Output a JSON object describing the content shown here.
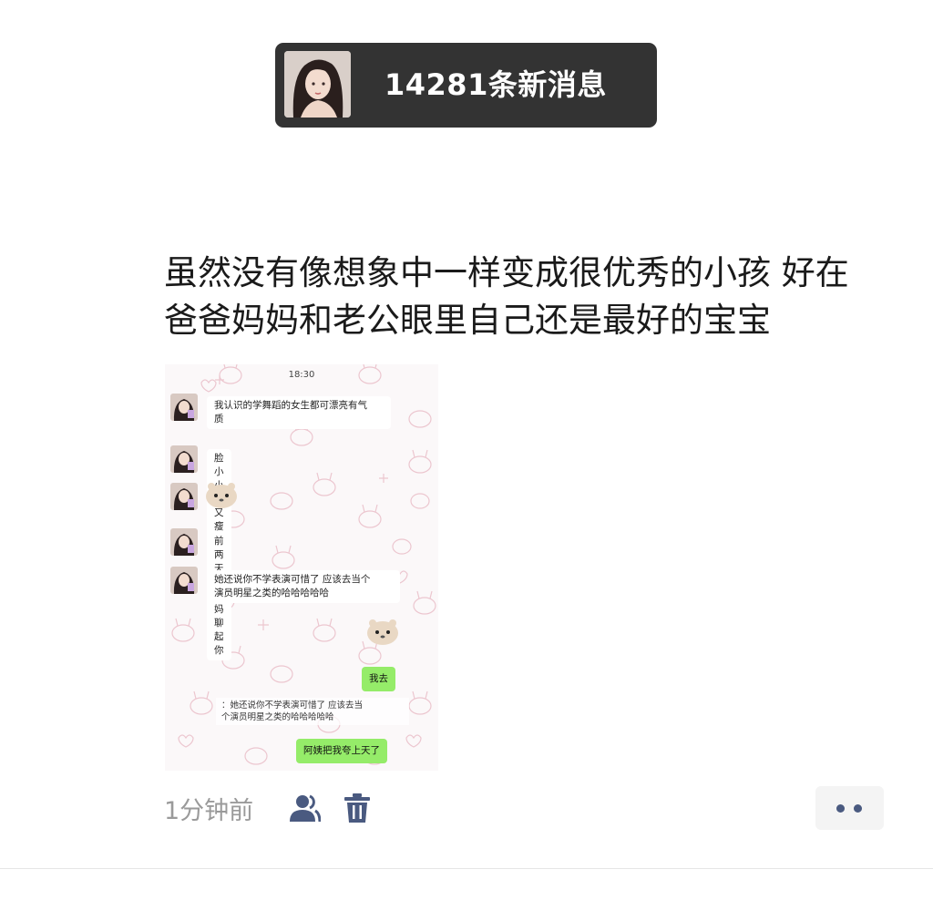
{
  "notification": {
    "count_text": "14281条新消息"
  },
  "post": {
    "text_line1": "虽然没有像想象中一样变成很优秀的小孩 好在",
    "text_line2": "爸爸妈妈和老公眼里自己还是最好的宝宝"
  },
  "chat_image": {
    "time": "18:30",
    "messages": [
      {
        "from": "other",
        "text_line1": "我认识的学舞蹈的女生都可漂亮有气",
        "text_line2": "质"
      },
      {
        "from": "other",
        "text": "脸小小的又瘦又高"
      },
      {
        "from": "other",
        "sticker": "bear-sticker"
      },
      {
        "from": "other",
        "text": "前两天和我妈聊起你"
      },
      {
        "from": "other",
        "text_line1": "她还说你不学表演可惜了 应该去当个",
        "text_line2": "演员明星之类的哈哈哈哈哈"
      },
      {
        "from": "self",
        "sticker": "bear-sticker"
      },
      {
        "from": "self",
        "text": "我去"
      },
      {
        "from": "quote",
        "text_line1": "：她还说你不学表演可惜了 应该去当",
        "text_line2": "个演员明星之类的哈哈哈哈哈"
      },
      {
        "from": "self",
        "text": "阿姨把我夸上天了"
      }
    ]
  },
  "footer": {
    "time_ago": "1分钟前",
    "friends_icon": "friends-icon",
    "trash_icon": "trash-icon",
    "more_icon": "more-dots-icon"
  },
  "colors": {
    "notification_bg": "#333333",
    "self_bubble": "#95ec69",
    "icon_blue": "#4a5a80",
    "time_gray": "#9a9a9a"
  }
}
